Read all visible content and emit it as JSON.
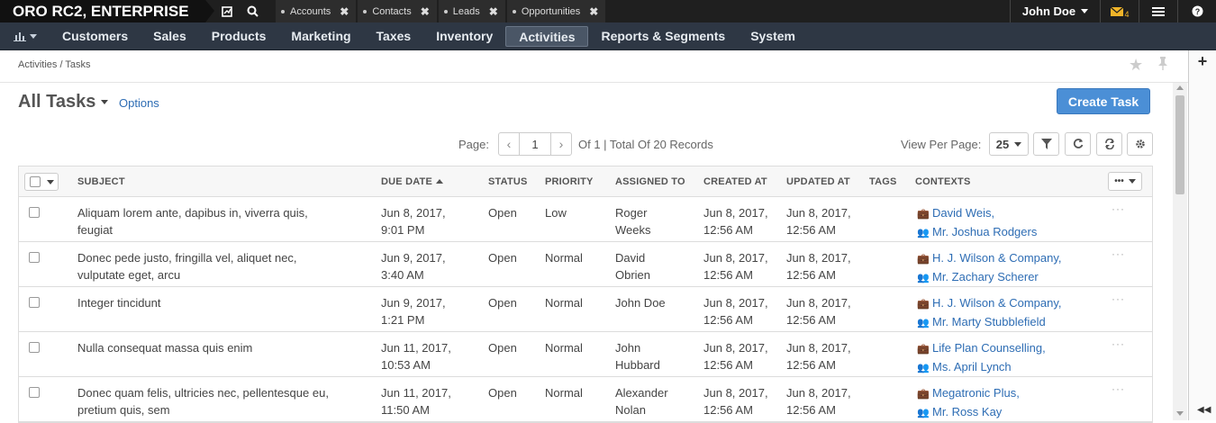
{
  "topbar": {
    "brand": "ORO RC2, ENTERPRISE",
    "tabs": [
      {
        "label": "Accounts"
      },
      {
        "label": "Contacts"
      },
      {
        "label": "Leads"
      },
      {
        "label": "Opportunities"
      }
    ],
    "user": "John Doe",
    "notification_count": "4"
  },
  "menu": {
    "items": [
      "Customers",
      "Sales",
      "Products",
      "Marketing",
      "Taxes",
      "Inventory",
      "Activities",
      "Reports & Segments",
      "System"
    ],
    "active": "Activities"
  },
  "breadcrumb": "Activities / Tasks",
  "page": {
    "title": "All Tasks",
    "options_label": "Options",
    "create_label": "Create Task"
  },
  "pager": {
    "label": "Page:",
    "current": "1",
    "info": "Of 1 | Total Of 20 Records",
    "view_per_page_label": "View Per Page:",
    "per_page": "25"
  },
  "grid": {
    "columns": [
      "SUBJECT",
      "DUE DATE",
      "STATUS",
      "PRIORITY",
      "ASSIGNED TO",
      "CREATED AT",
      "UPDATED AT",
      "TAGS",
      "CONTEXTS"
    ],
    "rows": [
      {
        "subject": [
          "Aliquam lorem ante, dapibus in, viverra quis,",
          "feugiat"
        ],
        "due": [
          "Jun 8, 2017,",
          "9:01 PM"
        ],
        "status": "Open",
        "priority": "Low",
        "assigned": [
          "Roger",
          "Weeks"
        ],
        "created": [
          "Jun 8, 2017,",
          "12:56 AM"
        ],
        "updated": [
          "Jun 8, 2017,",
          "12:56 AM"
        ],
        "ctx1": "David Weis,",
        "ctx2": "Mr. Joshua Rodgers"
      },
      {
        "subject": [
          "Donec pede justo, fringilla vel, aliquet nec,",
          "vulputate eget, arcu"
        ],
        "due": [
          "Jun 9, 2017,",
          "3:40 AM"
        ],
        "status": "Open",
        "priority": "Normal",
        "assigned": [
          "David",
          "Obrien"
        ],
        "created": [
          "Jun 8, 2017,",
          "12:56 AM"
        ],
        "updated": [
          "Jun 8, 2017,",
          "12:56 AM"
        ],
        "ctx1": "H. J. Wilson & Company,",
        "ctx2": "Mr. Zachary Scherer"
      },
      {
        "subject": [
          "Integer tincidunt",
          ""
        ],
        "due": [
          "Jun 9, 2017,",
          "1:21 PM"
        ],
        "status": "Open",
        "priority": "Normal",
        "assigned": [
          "John Doe",
          ""
        ],
        "created": [
          "Jun 8, 2017,",
          "12:56 AM"
        ],
        "updated": [
          "Jun 8, 2017,",
          "12:56 AM"
        ],
        "ctx1": "H. J. Wilson & Company,",
        "ctx2": "Mr. Marty Stubblefield"
      },
      {
        "subject": [
          "Nulla consequat massa quis enim",
          ""
        ],
        "due": [
          "Jun 11, 2017,",
          "10:53 AM"
        ],
        "status": "Open",
        "priority": "Normal",
        "assigned": [
          "John",
          "Hubbard"
        ],
        "created": [
          "Jun 8, 2017,",
          "12:56 AM"
        ],
        "updated": [
          "Jun 8, 2017,",
          "12:56 AM"
        ],
        "ctx1": "Life Plan Counselling,",
        "ctx2": "Ms. April Lynch"
      },
      {
        "subject": [
          "Donec quam felis, ultricies nec, pellentesque eu,",
          "pretium quis, sem"
        ],
        "due": [
          "Jun 11, 2017,",
          "11:50 AM"
        ],
        "status": "Open",
        "priority": "Normal",
        "assigned": [
          "Alexander",
          "Nolan"
        ],
        "created": [
          "Jun 8, 2017,",
          "12:56 AM"
        ],
        "updated": [
          "Jun 8, 2017,",
          "12:56 AM"
        ],
        "ctx1": "Megatronic Plus,",
        "ctx2": "Mr. Ross Kay"
      }
    ]
  },
  "colors": {
    "topbar": "#1f1f1f",
    "menubar": "#2e3744",
    "link": "#2e6db4",
    "primary_button": "#4b8fd6",
    "notification": "#f0b429"
  }
}
